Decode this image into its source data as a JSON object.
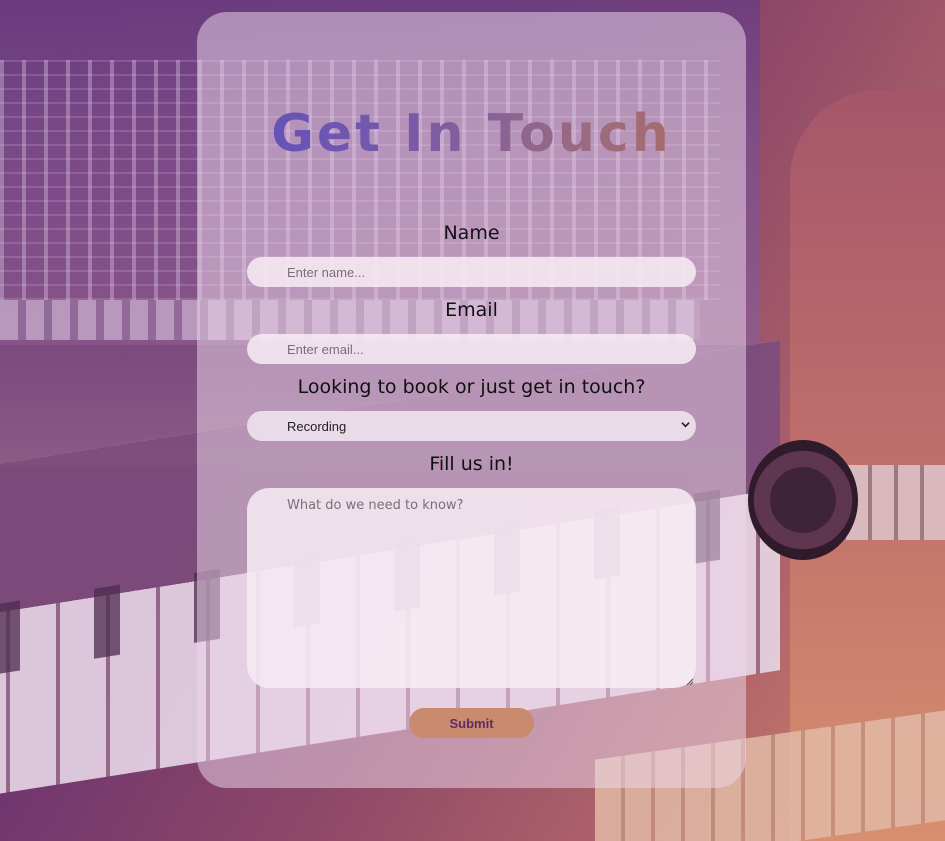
{
  "form": {
    "title": "Get In Touch",
    "name": {
      "label": "Name",
      "placeholder": "Enter name..."
    },
    "email": {
      "label": "Email",
      "placeholder": "Enter email..."
    },
    "inquiry": {
      "label": "Looking to book or just get in touch?",
      "selected": "Recording"
    },
    "message": {
      "label": "Fill us in!",
      "placeholder": "What do we need to know?"
    },
    "submit_label": "Submit"
  },
  "colors": {
    "title_gradient_start": "#5b4fbf",
    "title_gradient_end": "#b06f5c",
    "submit_bg": "#c98a6d",
    "submit_text": "#5a2d6b"
  },
  "icons": {
    "select_arrow": "chevron-down-icon",
    "textarea_resize": "resize-grip-icon"
  }
}
